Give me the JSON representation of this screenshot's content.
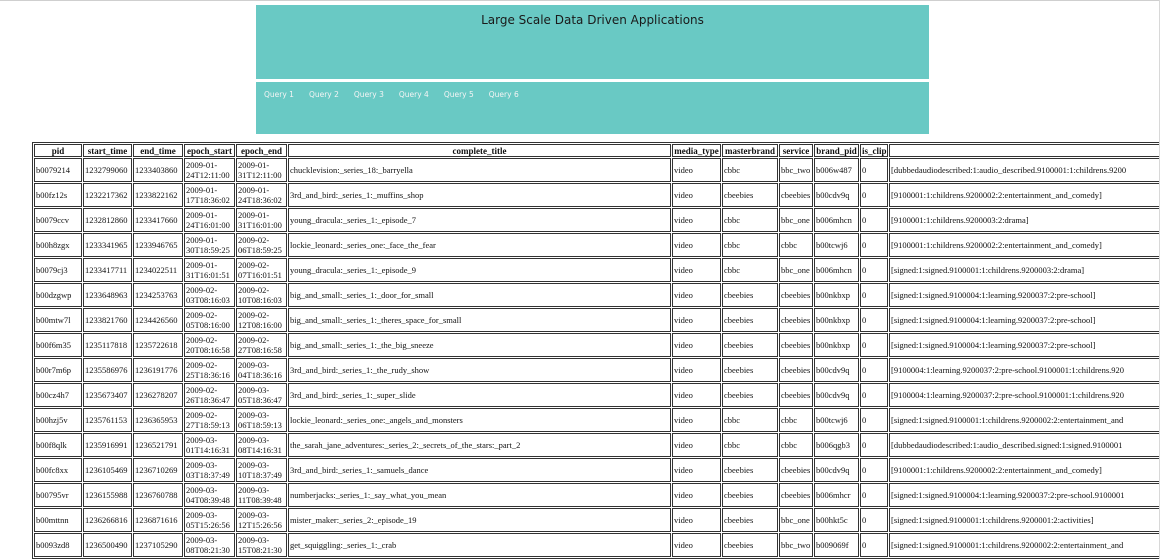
{
  "header": {
    "title": "Large Scale Data Driven Applications"
  },
  "nav": {
    "links": [
      "Query 1",
      "Query 2",
      "Query 3",
      "Query 4",
      "Query 5",
      "Query 6"
    ]
  },
  "table": {
    "columns": [
      "pid",
      "start_time",
      "end_time",
      "epoch_start",
      "epoch_end",
      "complete_title",
      "media_type",
      "masterbrand",
      "service",
      "brand_pid",
      "is_clip",
      ""
    ],
    "rows": [
      [
        "b0079214",
        "1232799060",
        "1233403860",
        "2009-01-24T12:11:00",
        "2009-01-31T12:11:00",
        "chucklevision:_series_18:_barryella",
        "video",
        "cbbc",
        "bbc_two",
        "b006w487",
        "0",
        "[dubbedaudiodescribed:1:audio_described.9100001:1:childrens.9200"
      ],
      [
        "b00fz12s",
        "1232217362",
        "1233822162",
        "2009-01-17T18:36:02",
        "2009-01-24T18:36:02",
        "3rd_and_bird:_series_1:_muffins_shop",
        "video",
        "cbeebies",
        "cbeebies",
        "b00cdv9q",
        "0",
        "[9100001:1:childrens.9200002:2:entertainment_and_comedy]"
      ],
      [
        "b0079ccv",
        "1232812860",
        "1233417660",
        "2009-01-24T16:01:00",
        "2009-01-31T16:01:00",
        "young_dracula:_series_1:_episode_7",
        "video",
        "cbbc",
        "bbc_one",
        "b006mhcn",
        "0",
        "[9100001:1:childrens.9200003:2:drama]"
      ],
      [
        "b00h8zgx",
        "1233341965",
        "1233946765",
        "2009-01-30T18:59:25",
        "2009-02-06T18:59:25",
        "lockie_leonard:_series_one:_face_the_fear",
        "video",
        "cbbc",
        "cbbc",
        "b00tcwj6",
        "0",
        "[9100001:1:childrens.9200002:2:entertainment_and_comedy]"
      ],
      [
        "b0079cj3",
        "1233417711",
        "1234022511",
        "2009-01-31T16:01:51",
        "2009-02-07T16:01:51",
        "young_dracula:_series_1:_episode_9",
        "video",
        "cbbc",
        "bbc_one",
        "b006mhcn",
        "0",
        "[signed:1:signed.9100001:1:childrens.9200003:2:drama]"
      ],
      [
        "b00dzgwp",
        "1233648963",
        "1234253763",
        "2009-02-03T08:16:03",
        "2009-02-10T08:16:03",
        "big_and_small:_series_1:_door_for_small",
        "video",
        "cbeebies",
        "cbeebies",
        "b00nkbxp",
        "0",
        "[signed:1:signed.9100004:1:learning.9200037:2:pre-school]"
      ],
      [
        "b00mtw7l",
        "1233821760",
        "1234426560",
        "2009-02-05T08:16:00",
        "2009-02-12T08:16:00",
        "big_and_small:_series_1:_theres_space_for_small",
        "video",
        "cbeebies",
        "cbeebies",
        "b00nkbxp",
        "0",
        "[signed:1:signed.9100004:1:learning.9200037:2:pre-school]"
      ],
      [
        "b00f6m35",
        "1235117818",
        "1235722618",
        "2009-02-20T08:16:58",
        "2009-02-27T08:16:58",
        "big_and_small:_series_1:_the_big_sneeze",
        "video",
        "cbeebies",
        "cbeebies",
        "b00nkbxp",
        "0",
        "[signed:1:signed.9100004:1:learning.9200037:2:pre-school]"
      ],
      [
        "b00r7m6p",
        "1235586976",
        "1236191776",
        "2009-02-25T18:36:16",
        "2009-03-04T18:36:16",
        "3rd_and_bird:_series_1:_the_rudy_show",
        "video",
        "cbeebies",
        "cbeebies",
        "b00cdv9q",
        "0",
        "[9100004:1:learning.9200037:2:pre-school.9100001:1:childrens.920"
      ],
      [
        "b00cz4h7",
        "1235673407",
        "1236278207",
        "2009-02-26T18:36:47",
        "2009-03-05T18:36:47",
        "3rd_and_bird:_series_1:_super_slide",
        "video",
        "cbeebies",
        "cbeebies",
        "b00cdv9q",
        "0",
        "[9100004:1:learning.9200037:2:pre-school.9100001:1:childrens.920"
      ],
      [
        "b00hzj5v",
        "1235761153",
        "1236365953",
        "2009-02-27T18:59:13",
        "2009-03-06T18:59:13",
        "lockie_leonard:_series_one:_angels_and_monsters",
        "video",
        "cbbc",
        "cbbc",
        "b00tcwj6",
        "0",
        "[signed:1:signed.9100001:1:childrens.9200002:2:entertainment_and"
      ],
      [
        "b00f8qlk",
        "1235916991",
        "1236521791",
        "2009-03-01T14:16:31",
        "2009-03-08T14:16:31",
        "the_sarah_jane_adventures:_series_2:_secrets_of_the_stars:_part_2",
        "video",
        "cbbc",
        "cbbc",
        "b006qgb3",
        "0",
        "[dubbedaudiodescribed:1:audio_described.signed:1:signed.9100001"
      ],
      [
        "b00fc8xx",
        "1236105469",
        "1236710269",
        "2009-03-03T18:37:49",
        "2009-03-10T18:37:49",
        "3rd_and_bird:_series_1:_samuels_dance",
        "video",
        "cbeebies",
        "cbeebies",
        "b00cdv9q",
        "0",
        "[9100001:1:childrens.9200002:2:entertainment_and_comedy]"
      ],
      [
        "b00795vr",
        "1236155988",
        "1236760788",
        "2009-03-04T08:39:48",
        "2009-03-11T08:39:48",
        "numberjacks:_series_1:_say_what_you_mean",
        "video",
        "cbeebies",
        "cbeebies",
        "b006mhcr",
        "0",
        "[signed:1:signed.9100004:1:learning.9200037:2:pre-school.9100001"
      ],
      [
        "b00mttnn",
        "1236266816",
        "1236871616",
        "2009-03-05T15:26:56",
        "2009-03-12T15:26:56",
        "mister_maker:_series_2:_episode_19",
        "video",
        "cbeebies",
        "bbc_one",
        "b00hkt5c",
        "0",
        "[signed:1:signed.9100001:1:childrens.9200001:2:activities]"
      ],
      [
        "b0093zd8",
        "1236500490",
        "1237105290",
        "2009-03-08T08:21:30",
        "2009-03-15T08:21:30",
        "get_squiggling:_series_1:_crab",
        "video",
        "cbeebies",
        "bbc_two",
        "b009069f",
        "0",
        "[signed:1:signed.9100001:1:childrens.9200002:2:entertainment_and"
      ]
    ]
  }
}
